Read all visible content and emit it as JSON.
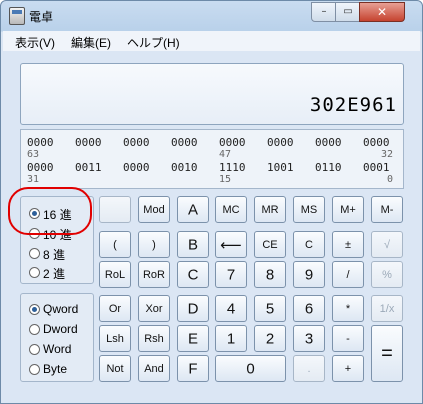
{
  "window": {
    "title": "電卓",
    "min": "–",
    "max": "▭",
    "close": "✕"
  },
  "menu": [
    "表示(V)",
    "編集(E)",
    "ヘルプ(H)"
  ],
  "display": {
    "value": "302E961"
  },
  "bits": {
    "row1": [
      "0000",
      "0000",
      "0000",
      "0000",
      "0000",
      "0000",
      "0000",
      "0000"
    ],
    "row1_pos": [
      "63",
      "47",
      "32"
    ],
    "row2": [
      "0000",
      "0011",
      "0000",
      "0010",
      "1110",
      "1001",
      "0110",
      "0001"
    ],
    "row2_pos": [
      "31",
      "15",
      "0"
    ]
  },
  "base": {
    "selected": "16 進",
    "options": [
      "16 進",
      "10 進",
      "8 進",
      "2 進"
    ]
  },
  "word": {
    "selected": "Qword",
    "options": [
      "Qword",
      "Dword",
      "Word",
      "Byte"
    ]
  },
  "keys": {
    "mod": "Mod",
    "a": "A",
    "mc": "MC",
    "mr": "MR",
    "ms": "MS",
    "mplus": "M+",
    "mminus": "M-",
    "lparen": "(",
    "rparen": ")",
    "b": "B",
    "back": "⟵",
    "ce": "CE",
    "c": "C",
    "plusminus": "±",
    "sqrt": "√",
    "rol": "RoL",
    "ror": "RoR",
    "hc": "C",
    "n7": "7",
    "n8": "8",
    "n9": "9",
    "div": "/",
    "pct": "%",
    "or": "Or",
    "xor": "Xor",
    "d": "D",
    "n4": "4",
    "n5": "5",
    "n6": "6",
    "mul": "*",
    "recip": "1/x",
    "lsh": "Lsh",
    "rsh": "Rsh",
    "e": "E",
    "n1": "1",
    "n2": "2",
    "n3": "3",
    "minus": "-",
    "not": "Not",
    "and": "And",
    "f": "F",
    "n0": "0",
    "dot": ".",
    "plus": "+",
    "equals": "="
  }
}
